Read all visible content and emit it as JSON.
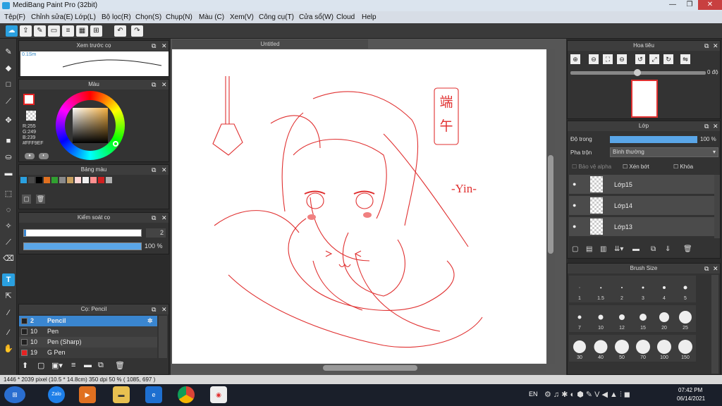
{
  "window": {
    "title": "MediBang Paint Pro (32bit)",
    "min": "—",
    "max": "❐",
    "close": "✕"
  },
  "menu": [
    "Tệp(F)",
    "Chỉnh sửa(E)",
    "Lớp(L)",
    "Bộ lọc(R)",
    "Chọn(S)",
    "Chụp(N)",
    "Màu (C)",
    "Xem(V)",
    "Công cụ(T)",
    "Cửa sổ(W)",
    "Cloud",
    "Help"
  ],
  "brush_preview": {
    "title": "Xem trước cọ",
    "size": "0.1Sm"
  },
  "color": {
    "title": "Màu",
    "r": "R:255",
    "g": "G:249",
    "b": "B:239",
    "hex": "#FFF9EF",
    "primary": "#ffffff",
    "accent": "#e62222"
  },
  "palette": {
    "title": "Bảng màu",
    "colors": [
      "#2aa0e0",
      "#4a4a4a",
      "#000000",
      "#e07020",
      "#30a030",
      "#8a8a8a",
      "#c8a060",
      "#ffd8d8",
      "#f0f0f0",
      "#ff9090",
      "#d02020",
      "#b0b0b0"
    ]
  },
  "brush_control": {
    "title": "Kiểm soát cọ",
    "size": "2",
    "opacity": "100 %",
    "size_level": 0.01,
    "opacity_level": 1.0
  },
  "brush_list": {
    "title": "Cọ: Pencil",
    "items": [
      {
        "size": "2",
        "name": "Pencil"
      },
      {
        "size": "10",
        "name": "Pen"
      },
      {
        "size": "10",
        "name": "Pen (Sharp)"
      },
      {
        "size": "19",
        "name": "G Pen"
      }
    ]
  },
  "document": {
    "tab": "Untitled",
    "signature": "-Yin-",
    "stamp": "端午"
  },
  "navigator": {
    "title": "Hoa tiêu",
    "angle": "0 độ"
  },
  "layers": {
    "title": "Lớp",
    "opacity_label": "Độ trong",
    "opacity": "100 %",
    "blend_label": "Pha trộn",
    "blend": "Bình thường",
    "alpha_lock": "Bảo vệ alpha",
    "clip": "Xén bớt",
    "lock": "Khóa",
    "items": [
      "Lớp15",
      "Lớp14",
      "Lớp13"
    ]
  },
  "brush_size": {
    "title": "Brush Size",
    "rows": [
      [
        "1",
        "1.5",
        "2",
        "3",
        "4",
        "5"
      ],
      [
        "7",
        "10",
        "12",
        "15",
        "20",
        "25"
      ],
      [
        "30",
        "40",
        "50",
        "70",
        "100",
        "150"
      ]
    ]
  },
  "status": {
    "text": "1446 * 2039 pixel   (10.5 * 14.8cm)   350 dpi   50 %   ( 1085, 697 )"
  },
  "taskbar": {
    "lang": "EN",
    "time": "07:42 PM",
    "date": "06/14/2021",
    "zalo": "Zalo"
  }
}
